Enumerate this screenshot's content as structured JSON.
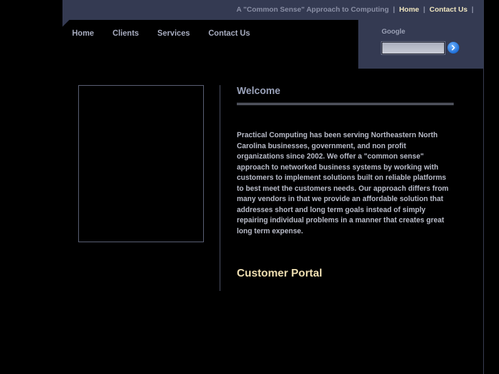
{
  "topbar": {
    "tagline": "A \"Common Sense\" Approach to Computing",
    "links": [
      {
        "label": "Home"
      },
      {
        "label": "Contact Us"
      }
    ]
  },
  "nav": {
    "items": [
      {
        "label": "Home"
      },
      {
        "label": "Clients"
      },
      {
        "label": "Services"
      },
      {
        "label": "Contact Us"
      }
    ]
  },
  "search": {
    "label": "Google",
    "value": "",
    "placeholder": "",
    "button_icon": "chevron-right-icon"
  },
  "main": {
    "title": "Welcome",
    "intro": "Practical Computing has been serving Northeastern North Carolina businesses, government, and non profit organizations since 2002. We offer a \"common sense\" approach to networked business systems by working with customers to implement solutions built on reliable platforms to best meet the customers needs. Our approach differs from many vendors in that we provide an affordable solution that addresses short and long term goals instead of simply repairing individual problems in a manner that creates great long term expense.",
    "portal_title": "Customer Portal"
  },
  "colors": {
    "background": "#000000",
    "bar": "#343a52",
    "link_accent": "#f0e6c0",
    "portal_accent": "#efdfb2",
    "body_text": "#b9bcc9",
    "button_blue": "#1f6fd8"
  }
}
